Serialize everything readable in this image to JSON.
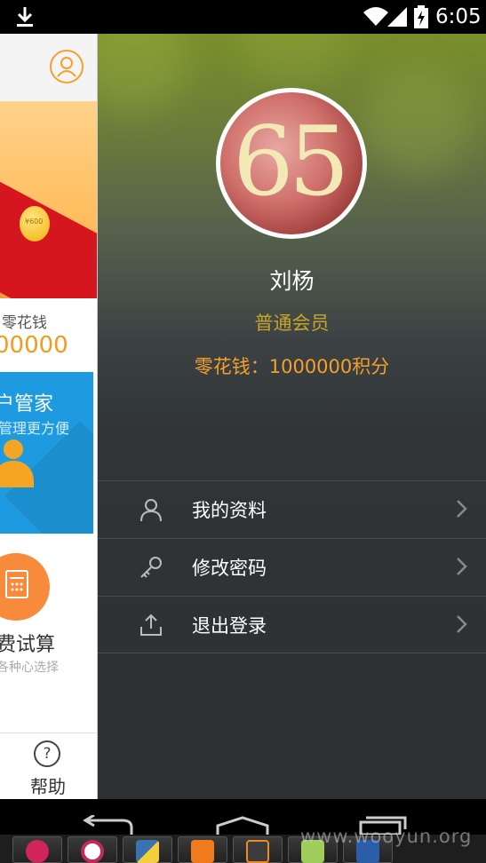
{
  "status_bar": {
    "time": "6:05"
  },
  "background_page": {
    "money_label": "零花钱",
    "money_value": "00000",
    "coin_text": "¥600",
    "card_title": "户管家",
    "card_subtitle": "管理更方便",
    "calc_title": "费试算",
    "calc_subtitle": "各种心选择",
    "help_label": "帮助",
    "help_icon_glyph": "?"
  },
  "drawer": {
    "avatar_text": "65",
    "user_name": "刘杨",
    "member_level": "普通会员",
    "points_text": "零花钱：1000000积分",
    "menu": [
      {
        "label": "我的资料",
        "icon": "person-icon"
      },
      {
        "label": "修改密码",
        "icon": "key-icon"
      },
      {
        "label": "退出登录",
        "icon": "logout-icon"
      }
    ]
  },
  "watermark": "www.wooyun.org",
  "colors": {
    "accent_orange": "#f5a02a",
    "level_gold": "#c8a42a",
    "drawer_bg": "#2e3133",
    "card_blue": "#1e9be0"
  }
}
